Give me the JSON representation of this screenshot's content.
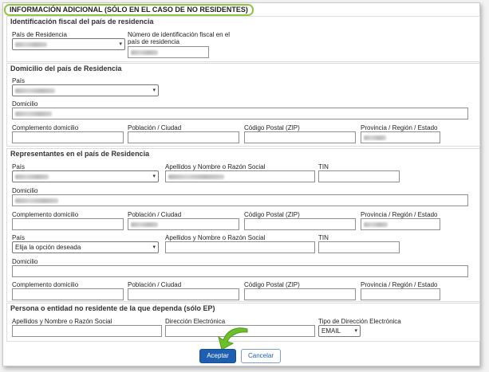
{
  "header": {
    "title": "INFORMACIÓN ADICIONAL (SÓLO EN EL CASO DE NO RESIDENTES)"
  },
  "fiscal": {
    "title": "Identificación fiscal del país de residencia",
    "pais_label": "País de Residencia",
    "nif_label_line1": "Número de identificación fiscal en el",
    "nif_label_line2": "país de residencia"
  },
  "domicilio": {
    "title": "Domicilio del país de Residencia",
    "pais_label": "País",
    "domicilio_label": "Domicilio",
    "complemento_label": "Complemento domicilio",
    "poblacion_label": "Población / Ciudad",
    "cp_label": "Código Postal (ZIP)",
    "provincia_label": "Provincia / Región / Estado"
  },
  "representantes": {
    "title": "Representantes en el país de Residencia",
    "rep1": {
      "pais_label": "País",
      "apellidos_label": "Apellidos y Nombre o Razón Social",
      "tin_label": "TIN",
      "domicilio_label": "Domicilio",
      "complemento_label": "Complemento domicilio",
      "poblacion_label": "Población / Ciudad",
      "cp_label": "Código Postal (ZIP)",
      "provincia_label": "Provincia / Región / Estado"
    },
    "rep2": {
      "pais_label": "País",
      "pais_value": "Elija la opción deseada",
      "apellidos_label": "Apellidos y Nombre o Razón Social",
      "tin_label": "TIN",
      "domicilio_label": "Domicilio",
      "complemento_label": "Complemento domicilio",
      "poblacion_label": "Población / Ciudad",
      "cp_label": "Código Postal (ZIP)",
      "provincia_label": "Provincia / Región / Estado"
    }
  },
  "entidad": {
    "title": "Persona o entidad no residente de la que dependa (sólo EP)",
    "apellidos_label": "Apellidos y Nombre o Razón Social",
    "direccion_label": "Dirección Electrónica",
    "tipo_label": "Tipo de Dirección Electrónica",
    "tipo_value": "EMAIL"
  },
  "buttons": {
    "accept": "Aceptar",
    "cancel": "Cancelar"
  },
  "colors": {
    "highlight": "#8dc63f",
    "accept": "#1f5fb0",
    "arrow": "#6cbf2a"
  },
  "icons": {
    "dropdown": "chevron-down-icon",
    "annotation": "green-arrow-icon"
  }
}
